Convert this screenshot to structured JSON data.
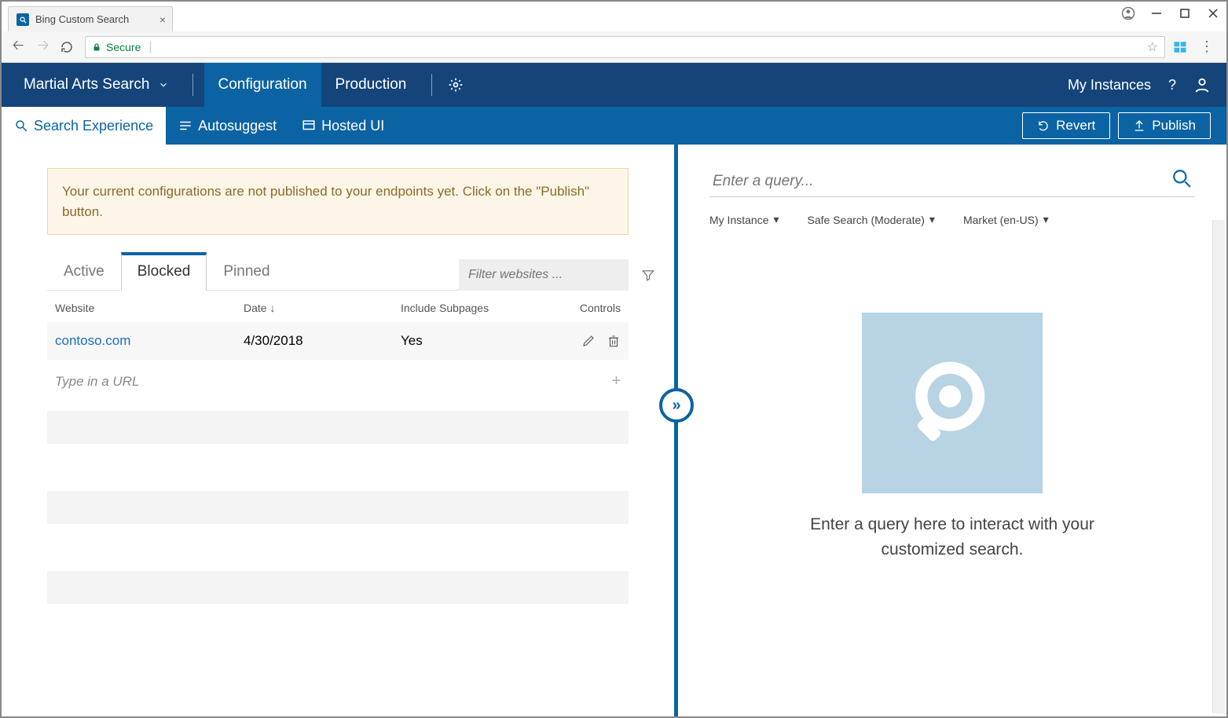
{
  "browser": {
    "tab_title": "Bing Custom Search",
    "secure_label": "Secure"
  },
  "header": {
    "instance_name": "Martial Arts Search",
    "tabs": {
      "configuration": "Configuration",
      "production": "Production"
    },
    "my_instances": "My Instances"
  },
  "subnav": {
    "search_experience": "Search Experience",
    "autosuggest": "Autosuggest",
    "hosted_ui": "Hosted UI",
    "revert": "Revert",
    "publish": "Publish"
  },
  "notice": "Your current configurations are not published to your endpoints yet. Click on the \"Publish\" button.",
  "config_tabs": {
    "active": "Active",
    "blocked": "Blocked",
    "pinned": "Pinned"
  },
  "filter_placeholder": "Filter websites ...",
  "table": {
    "headers": {
      "website": "Website",
      "date": "Date",
      "include_subpages": "Include Subpages",
      "controls": "Controls"
    },
    "rows": [
      {
        "website": "contoso.com",
        "date": "4/30/2018",
        "include_subpages": "Yes"
      }
    ],
    "add_placeholder": "Type in a URL"
  },
  "preview": {
    "query_placeholder": "Enter a query...",
    "facets": {
      "instance": "My Instance",
      "safe": "Safe Search (Moderate)",
      "market": "Market (en-US)"
    },
    "empty_text_1": "Enter a query here to interact with your",
    "empty_text_2": "customized search."
  }
}
